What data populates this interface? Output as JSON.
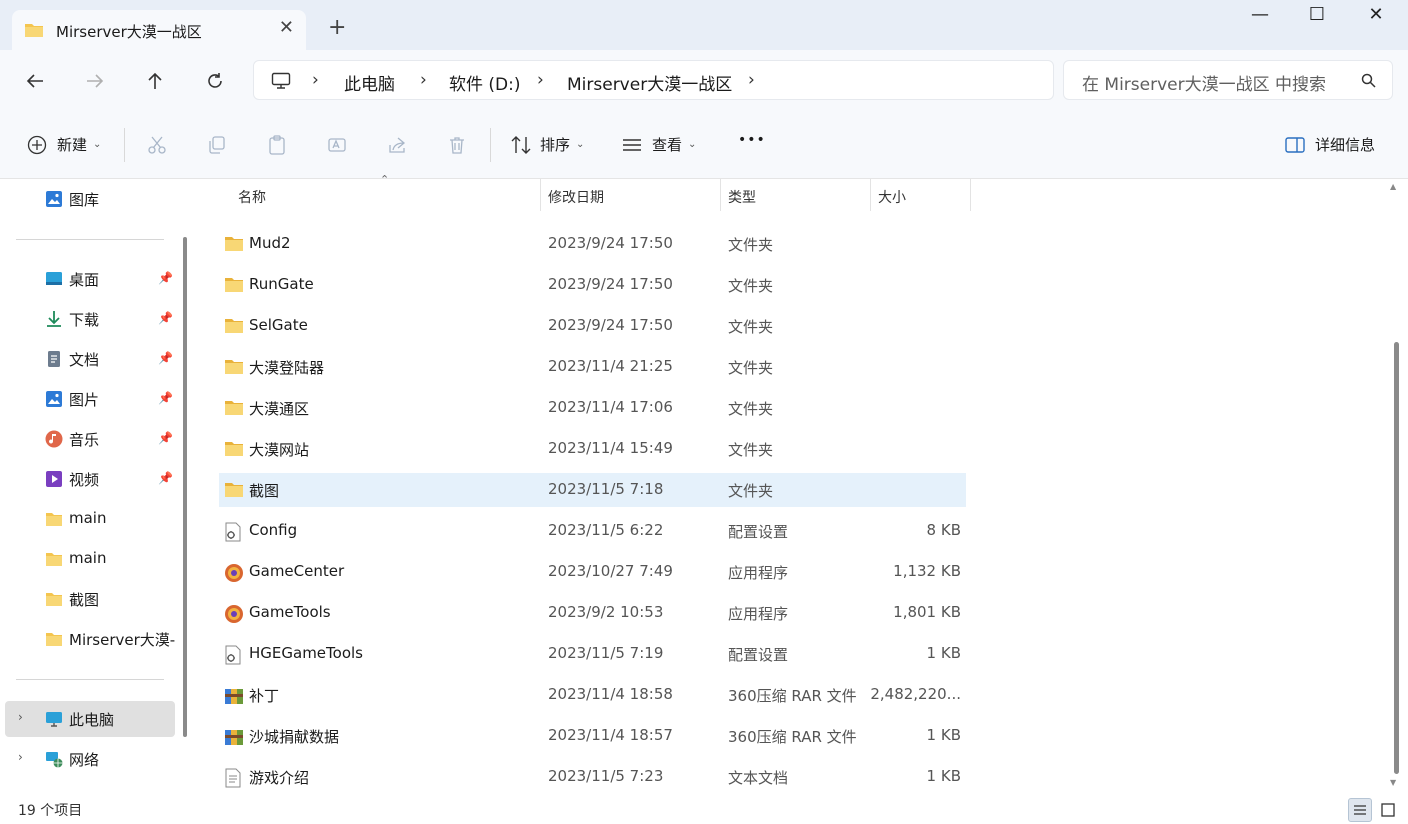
{
  "window": {
    "tab_title": "Mirserver大漠一战区",
    "new_tab": "+",
    "minimize": "—",
    "maximize": "☐",
    "close": "✕",
    "tab_close": "✕"
  },
  "nav": {
    "back_icon": "arrow-left-icon",
    "forward_icon": "arrow-right-icon",
    "up_icon": "arrow-up-icon",
    "refresh_icon": "refresh-icon"
  },
  "address": {
    "segments": [
      "此电脑",
      "软件 (D:)",
      "Mirserver大漠一战区"
    ],
    "separator": "›"
  },
  "search": {
    "placeholder": "在 Mirserver大漠一战区 中搜索"
  },
  "toolbar": {
    "new_label": "新建",
    "sort_label": "排序",
    "view_label": "查看",
    "more_label": "•••",
    "details_label": "详细信息"
  },
  "sidebar": {
    "gallery": "图库",
    "quick_access": [
      {
        "label": "桌面",
        "icon": "desktop-icon",
        "pinned": true
      },
      {
        "label": "下载",
        "icon": "download-icon",
        "pinned": true
      },
      {
        "label": "文档",
        "icon": "document-icon",
        "pinned": true
      },
      {
        "label": "图片",
        "icon": "pictures-icon",
        "pinned": true
      },
      {
        "label": "音乐",
        "icon": "music-icon",
        "pinned": true
      },
      {
        "label": "视频",
        "icon": "video-icon",
        "pinned": true
      },
      {
        "label": "main",
        "icon": "folder-icon",
        "pinned": false
      },
      {
        "label": "main",
        "icon": "folder-icon",
        "pinned": false
      },
      {
        "label": "截图",
        "icon": "folder-icon",
        "pinned": false
      },
      {
        "label": "Mirserver大漠-",
        "icon": "folder-icon",
        "pinned": false
      }
    ],
    "this_pc": "此电脑",
    "network": "网络",
    "pin_glyph": "📌"
  },
  "columns": {
    "name": "名称",
    "date": "修改日期",
    "type": "类型",
    "size": "大小"
  },
  "files": [
    {
      "name": "Mud2",
      "date": "2023/9/24 17:50",
      "type": "文件夹",
      "size": "",
      "icon": "folder-icon"
    },
    {
      "name": "RunGate",
      "date": "2023/9/24 17:50",
      "type": "文件夹",
      "size": "",
      "icon": "folder-icon"
    },
    {
      "name": "SelGate",
      "date": "2023/9/24 17:50",
      "type": "文件夹",
      "size": "",
      "icon": "folder-icon"
    },
    {
      "name": "大漠登陆器",
      "date": "2023/11/4 21:25",
      "type": "文件夹",
      "size": "",
      "icon": "folder-icon"
    },
    {
      "name": "大漠通区",
      "date": "2023/11/4 17:06",
      "type": "文件夹",
      "size": "",
      "icon": "folder-icon"
    },
    {
      "name": "大漠网站",
      "date": "2023/11/4 15:49",
      "type": "文件夹",
      "size": "",
      "icon": "folder-icon"
    },
    {
      "name": "截图",
      "date": "2023/11/5 7:18",
      "type": "文件夹",
      "size": "",
      "icon": "folder-icon",
      "selected": true
    },
    {
      "name": "Config",
      "date": "2023/11/5 6:22",
      "type": "配置设置",
      "size": "8 KB",
      "icon": "config-file-icon"
    },
    {
      "name": "GameCenter",
      "date": "2023/10/27 7:49",
      "type": "应用程序",
      "size": "1,132 KB",
      "icon": "app-icon"
    },
    {
      "name": "GameTools",
      "date": "2023/9/2 10:53",
      "type": "应用程序",
      "size": "1,801 KB",
      "icon": "app-icon"
    },
    {
      "name": "HGEGameTools",
      "date": "2023/11/5 7:19",
      "type": "配置设置",
      "size": "1 KB",
      "icon": "config-file-icon"
    },
    {
      "name": "补丁",
      "date": "2023/11/4 18:58",
      "type": "360压缩 RAR 文件",
      "size": "2,482,220...",
      "icon": "rar-archive-icon"
    },
    {
      "name": "沙城捐献数据",
      "date": "2023/11/4 18:57",
      "type": "360压缩 RAR 文件",
      "size": "1 KB",
      "icon": "rar-archive-icon"
    },
    {
      "name": "游戏介绍",
      "date": "2023/11/5 7:23",
      "type": "文本文档",
      "size": "1 KB",
      "icon": "text-file-icon"
    }
  ],
  "status": {
    "item_count": "19 个项目"
  },
  "colors": {
    "folder": "#f4c54f",
    "selection": "#e5f1fb",
    "chrome": "#f7f9fc"
  }
}
